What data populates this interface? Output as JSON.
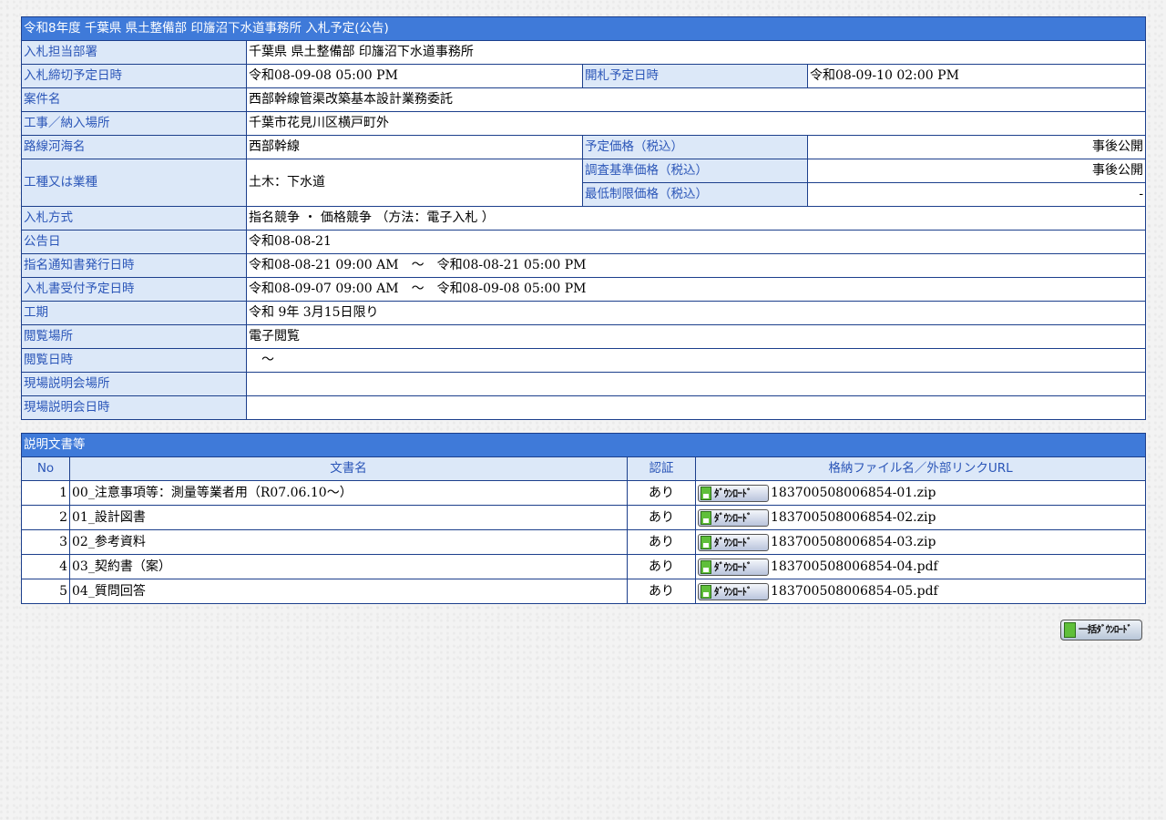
{
  "info": {
    "title": "令和8年度 千葉県 県土整備部 印旛沼下水道事務所 入札予定(公告)",
    "rows": [
      {
        "label": "入札担当部署",
        "value": "千葉県 県土整備部 印旛沼下水道事務所"
      },
      {
        "label": "入札締切予定日時",
        "value": "令和08-09-08 05:00 PM",
        "label2": "開札予定日時",
        "value2": "令和08-09-10 02:00 PM"
      },
      {
        "label": "案件名",
        "value": "西部幹線管渠改築基本設計業務委託"
      },
      {
        "label": "工事／納入場所",
        "value": "千葉市花見川区横戸町外"
      },
      {
        "label": "路線河海名",
        "value": "西部幹線",
        "label2": "予定価格（税込）",
        "value2": "事後公開"
      },
      {
        "label": "工種又は業種",
        "value": "土木：下水道",
        "label2": "調査基準価格（税込）",
        "value2": "事後公開"
      },
      {
        "label2": "最低制限価格（税込）",
        "value2": "-"
      },
      {
        "label": "入札方式",
        "value": "指名競争 ・ 価格競争 （方法：電子入札 ）"
      },
      {
        "label": "公告日",
        "value": "令和08-08-21"
      },
      {
        "label": "指名通知書発行日時",
        "value": "令和08-08-21 09:00 AM　～　令和08-08-21 05:00 PM"
      },
      {
        "label": "入札書受付予定日時",
        "value": "令和08-09-07 09:00 AM　～　令和08-09-08 05:00 PM"
      },
      {
        "label": "工期",
        "value": "令和 9年 3月15日限り"
      },
      {
        "label": "閲覧場所",
        "value": "電子閲覧"
      },
      {
        "label": "閲覧日時",
        "value": "　～"
      },
      {
        "label": "現場説明会場所",
        "value": ""
      },
      {
        "label": "現場説明会日時",
        "value": ""
      }
    ]
  },
  "docs": {
    "title": "説明文書等",
    "headers": [
      "No",
      "文書名",
      "認証",
      "格納ファイル名／外部リンクURL"
    ],
    "download_label": "ﾀﾞｳﾝﾛｰﾄﾞ",
    "rows": [
      {
        "no": "1",
        "name": "00_注意事項等：測量等業者用（R07.06.10～）",
        "cert": "あり",
        "file": "183700508006854-01.zip"
      },
      {
        "no": "2",
        "name": "01_設計図書",
        "cert": "あり",
        "file": "183700508006854-02.zip"
      },
      {
        "no": "3",
        "name": "02_参考資料",
        "cert": "あり",
        "file": "183700508006854-03.zip"
      },
      {
        "no": "4",
        "name": "03_契約書（案）",
        "cert": "あり",
        "file": "183700508006854-04.pdf"
      },
      {
        "no": "5",
        "name": "04_質問回答",
        "cert": "あり",
        "file": "183700508006854-05.pdf"
      }
    ],
    "bulk_download_label": "一括ﾀﾞｳﾝﾛｰﾄﾞ"
  }
}
